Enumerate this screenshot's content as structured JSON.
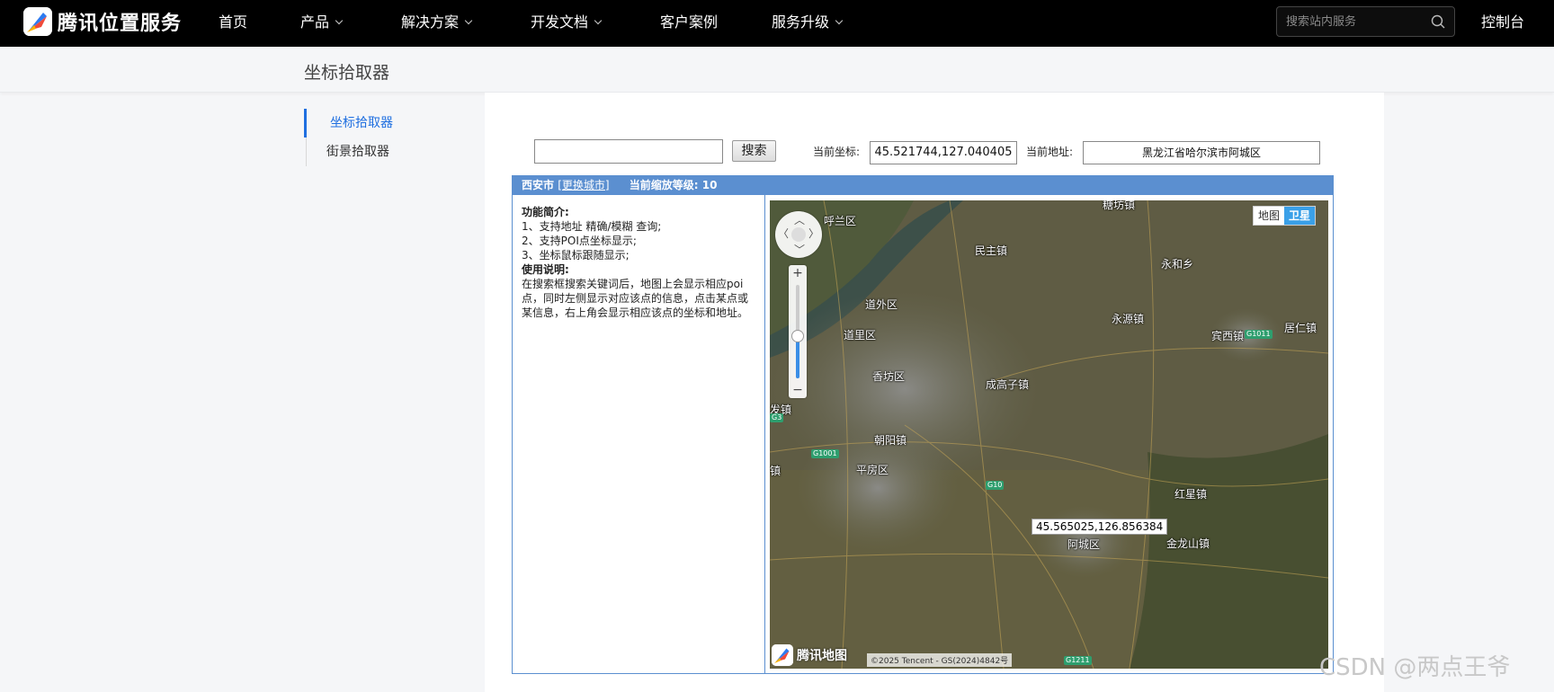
{
  "brand": {
    "name": "腾讯位置服务"
  },
  "nav": {
    "items": [
      {
        "label": "首页"
      },
      {
        "label": "产品"
      },
      {
        "label": "解决方案"
      },
      {
        "label": "开发文档"
      },
      {
        "label": "客户案例"
      },
      {
        "label": "服务升级"
      }
    ],
    "search_placeholder": "搜索站内服务",
    "console": "控制台"
  },
  "page": {
    "title": "坐标拾取器"
  },
  "sidebar": {
    "items": [
      {
        "label": "坐标拾取器",
        "active": true
      },
      {
        "label": "街景拾取器",
        "active": false
      }
    ]
  },
  "toolbar": {
    "keyword_value": "",
    "search_button": "搜索",
    "coord_label": "当前坐标:",
    "coord_value": "45.521744,127.040405",
    "addr_label": "当前地址:",
    "addr_value": "黑龙江省哈尔滨市阿城区"
  },
  "picker": {
    "city": "西安市",
    "change_city": "[更换城市]",
    "zoom_text": "当前缩放等级: 10",
    "intro_title": "功能简介:",
    "intro_lines": [
      "1、支持地址 精确/模糊 查询;",
      "2、支持POI点坐标显示;",
      "3、坐标鼠标跟随显示;"
    ],
    "usage_title": "使用说明:",
    "usage_text": "在搜索框搜索关键词后，地图上会显示相应poi点，同时左侧显示对应该点的信息，点击某点或某信息，右上角会显示相应该点的坐标和地址。"
  },
  "map": {
    "type_map": "地图",
    "type_sat": "卫星",
    "active_type": "卫星",
    "zoom_in": "+",
    "zoom_out": "−",
    "zoom_level_fraction": 0.45,
    "tooltip": "45.565025,126.856384",
    "logo_text": "腾讯地图",
    "copyright": "©2025 Tencent - GS(2024)4842号",
    "places": [
      "糖坊镇",
      "呼兰区",
      "民主镇",
      "永和乡",
      "道外区",
      "永源镇",
      "宾西镇",
      "居仁镇",
      "道里区",
      "香坊区",
      "成高子镇",
      "发镇",
      "朝阳镇",
      "平房区",
      "红星镇",
      "阿城区",
      "金龙山镇",
      "镇"
    ],
    "shields": [
      "G1011",
      "G1001",
      "G10",
      "G1211",
      "G3"
    ]
  },
  "watermark": "CSDN @两点王爷",
  "colors": {
    "accent": "#1f6fe0",
    "picker_blue": "#5b8fd0",
    "sat_btn": "#3aa0e8"
  }
}
